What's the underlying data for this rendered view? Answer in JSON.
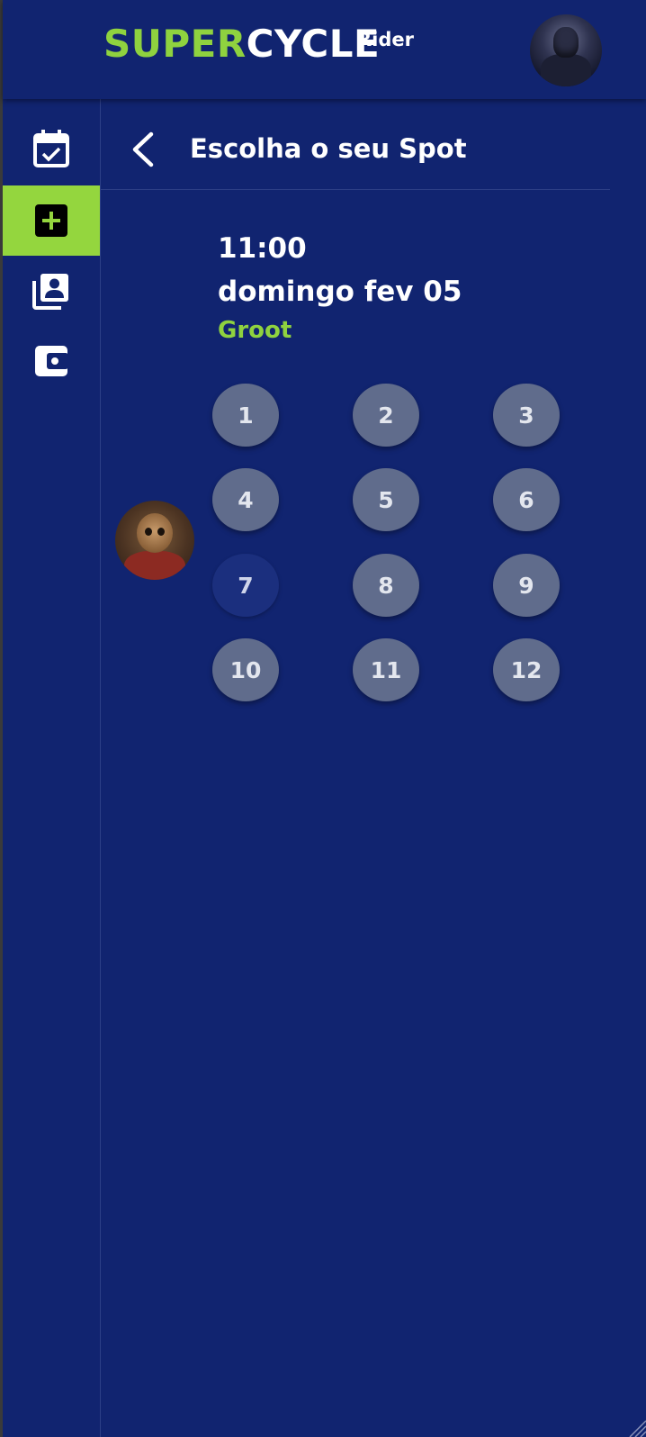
{
  "app": {
    "logo_super": "SUPER",
    "logo_cycle": "CYCLE",
    "logo_suffix": "Rider",
    "accent_color": "#8fd23f",
    "background_color": "#112470"
  },
  "user_avatar": {
    "icon": "user-avatar-icon"
  },
  "sidebar": {
    "items": [
      {
        "icon": "calendar-check-icon",
        "active": false
      },
      {
        "icon": "add-box-icon",
        "active": true
      },
      {
        "icon": "contacts-icon",
        "active": false
      },
      {
        "icon": "wallet-icon",
        "active": false
      }
    ]
  },
  "page": {
    "title": "Escolha o seu Spot",
    "back_icon": "chevron-left-icon"
  },
  "session": {
    "time": "11:00",
    "date": "domingo fev 05",
    "instructor": "Groot"
  },
  "spots": [
    {
      "label": "1",
      "status": "available"
    },
    {
      "label": "2",
      "status": "available"
    },
    {
      "label": "3",
      "status": "available"
    },
    {
      "label": "4",
      "status": "available"
    },
    {
      "label": "5",
      "status": "available"
    },
    {
      "label": "6",
      "status": "available"
    },
    {
      "label": "7",
      "status": "taken"
    },
    {
      "label": "8",
      "status": "available"
    },
    {
      "label": "9",
      "status": "available"
    },
    {
      "label": "10",
      "status": "available"
    },
    {
      "label": "11",
      "status": "available"
    },
    {
      "label": "12",
      "status": "available"
    }
  ]
}
